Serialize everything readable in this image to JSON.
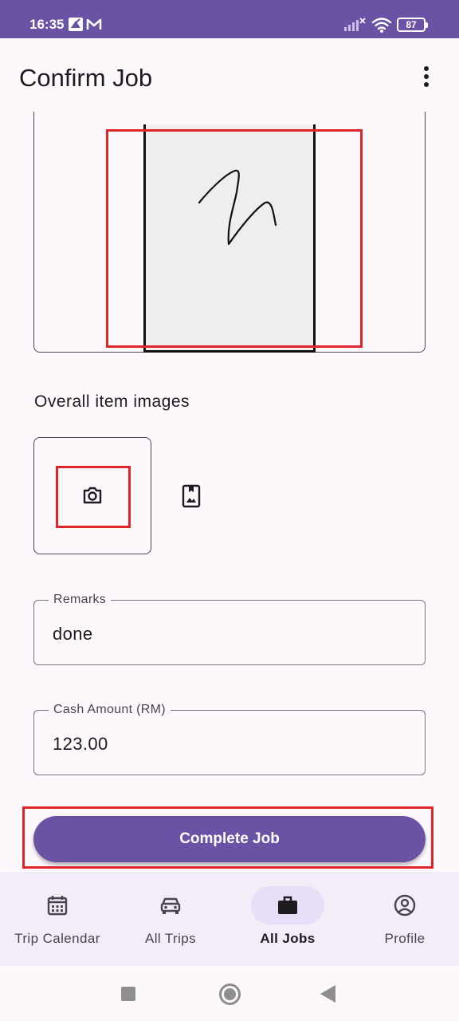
{
  "status_bar": {
    "time": "16:35",
    "battery": "87",
    "icons": [
      "notification-icon",
      "gmail-icon",
      "signal-icon",
      "wifi-icon",
      "battery-icon"
    ]
  },
  "app_bar": {
    "title": "Confirm Job",
    "menu_icon": "more-vert-icon"
  },
  "signature": {
    "pad_color": "#eeeeec",
    "highlight_color": "#e0262b"
  },
  "images_section": {
    "label": "Overall item images",
    "camera_icon": "camera-icon",
    "gallery_icon": "photo-library-icon"
  },
  "remarks": {
    "label": "Remarks",
    "value": "done"
  },
  "cash_amount": {
    "label": "Cash Amount (RM)",
    "value": "123.00"
  },
  "complete_button": {
    "label": "Complete Job",
    "color": "#6a52a5"
  },
  "bottom_nav": {
    "items": [
      {
        "label": "Trip Calendar",
        "icon": "calendar-icon"
      },
      {
        "label": "All Trips",
        "icon": "car-icon"
      },
      {
        "label": "All Jobs",
        "icon": "briefcase-icon",
        "active": true
      },
      {
        "label": "Profile",
        "icon": "account-circle-icon"
      }
    ]
  },
  "theme": {
    "primary": "#6a52a5",
    "background": "#fdf8fc",
    "nav_background": "#f3edf7",
    "nav_active_pill": "#e8def8"
  }
}
